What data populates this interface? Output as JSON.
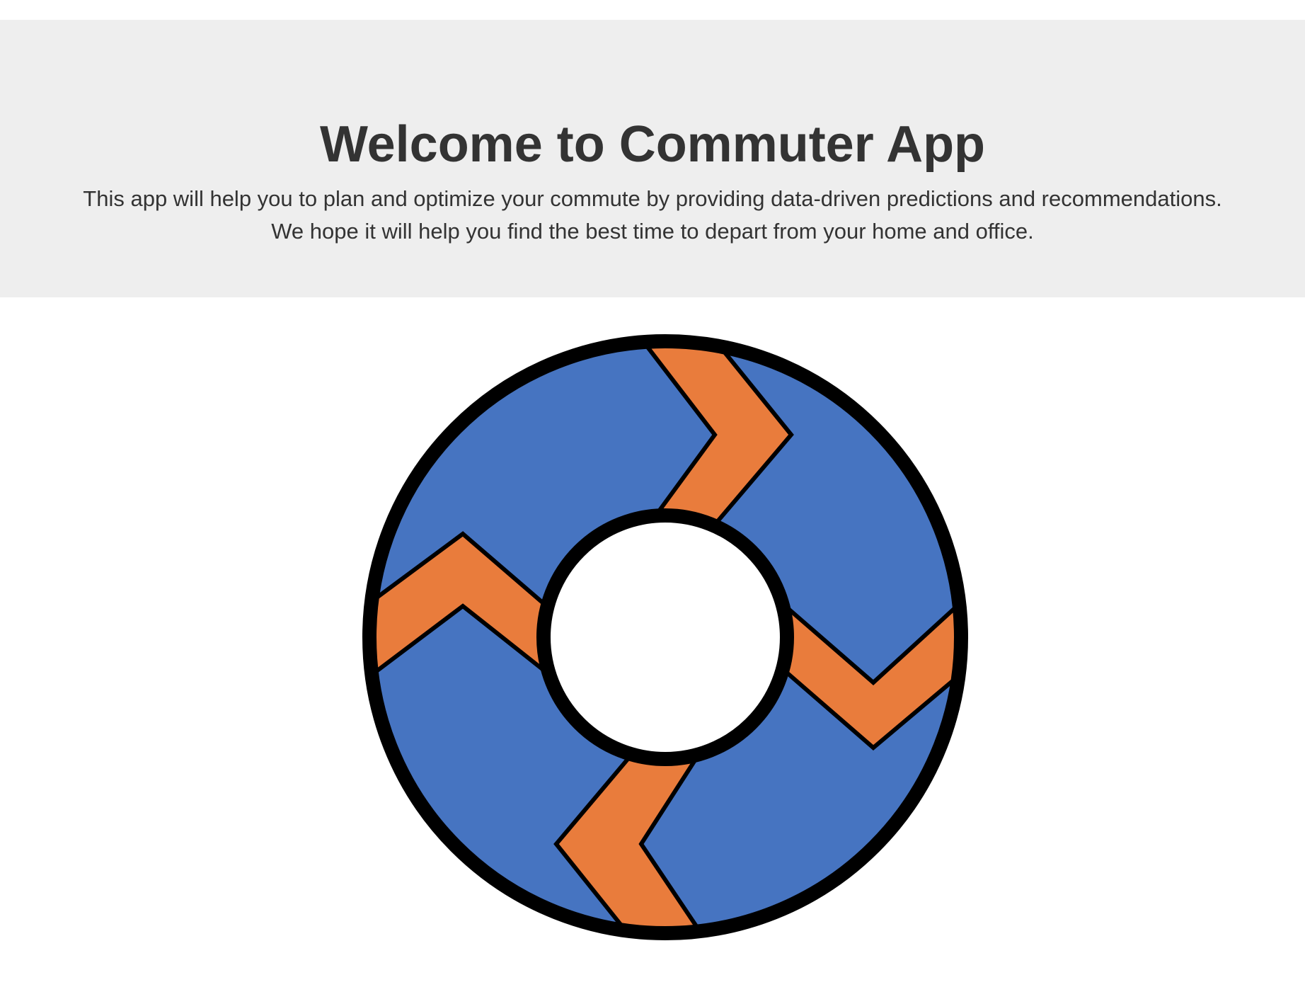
{
  "header": {
    "title": "Welcome to Commuter App",
    "description_line1": "This app will help you to plan and optimize your commute by providing data-driven predictions and recommendations.",
    "description_line2": "We hope it will help you find the best time to depart from your home and office."
  },
  "logo": {
    "icon": "commuter-app-logo-icon",
    "colors": {
      "ring": "#4674c1",
      "road": "#e97c3c",
      "outline": "#000000",
      "center": "#ffffff"
    }
  },
  "page": {
    "background": "#ffffff",
    "jumbotron_background": "#eeeeee",
    "text_color": "#333333"
  }
}
